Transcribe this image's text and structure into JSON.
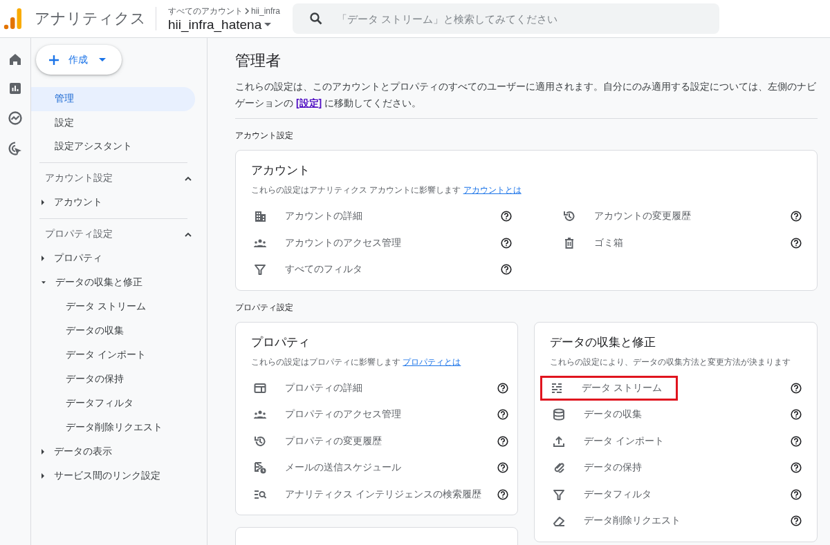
{
  "header": {
    "app_name": "アナリティクス",
    "breadcrumb": [
      "すべてのアカウント",
      "hii_infra"
    ],
    "property": "hii_infra_hatena",
    "search": {
      "placeholder": "「データ ストリーム」と検索してみてください"
    }
  },
  "create_button": {
    "label": "作成"
  },
  "nav": {
    "top_items": [
      {
        "label": "管理",
        "selected": true
      },
      {
        "label": "設定",
        "selected": false
      },
      {
        "label": "設定アシスタント",
        "selected": false
      }
    ],
    "sections": [
      {
        "title": "アカウント設定",
        "expanded": true,
        "items": [
          {
            "label": "アカウント",
            "expanded": false
          }
        ]
      },
      {
        "title": "プロパティ設定",
        "expanded": true,
        "items": [
          {
            "label": "プロパティ",
            "expanded": false
          },
          {
            "label": "データの収集と修正",
            "expanded": true,
            "children": [
              {
                "label": "データ ストリーム"
              },
              {
                "label": "データの収集"
              },
              {
                "label": "データ インポート"
              },
              {
                "label": "データの保持"
              },
              {
                "label": "データフィルタ"
              },
              {
                "label": "データ削除リクエスト"
              }
            ]
          },
          {
            "label": "データの表示",
            "expanded": false
          },
          {
            "label": "サービス間のリンク設定",
            "expanded": false
          }
        ]
      }
    ]
  },
  "main": {
    "title": "管理者",
    "description": {
      "text": "これらの設定は、このアカウントとプロパティのすべてのユーザーに適用されます。自分にのみ適用する設定については、左側のナビゲーションの",
      "link": "[設定]",
      "text_after": "に移動してください。"
    },
    "account_settings": {
      "heading": "アカウント設定",
      "card": {
        "title": "アカウント",
        "subtitle": "これらの設定はアナリティクス アカウントに影響します",
        "link": "アカウントとは",
        "items": [
          {
            "kind": "building",
            "label": "アカウントの詳細",
            "highlighted": false
          },
          {
            "kind": "people",
            "label": "アカウントのアクセス管理",
            "highlighted": false
          },
          {
            "kind": "filter",
            "label": "すべてのフィルタ",
            "highlighted": false
          },
          {
            "kind": "history",
            "label": "アカウントの変更履歴",
            "highlighted": false
          },
          {
            "kind": "trash",
            "label": "ゴミ箱",
            "highlighted": false
          }
        ]
      }
    },
    "property_settings": {
      "heading": "プロパティ設定",
      "columns": [
        [
          {
            "kind": "card",
            "title": "プロパティ",
            "subtitle": "これらの設定はプロパティに影響します",
            "link": "プロパティとは",
            "items": [
              {
                "kind": "window",
                "label": "プロパティの詳細",
                "highlighted": false
              },
              {
                "kind": "people",
                "label": "プロパティのアクセス管理",
                "highlighted": false
              },
              {
                "kind": "history",
                "label": "プロパティの変更履歴",
                "highlighted": false
              },
              {
                "kind": "mail-clock",
                "label": "メールの送信スケジュール",
                "highlighted": false
              },
              {
                "kind": "search-list",
                "label": "アナリティクス インテリジェンスの検索履歴",
                "highlighted": false
              }
            ]
          },
          {
            "kind": "partial"
          }
        ],
        [
          {
            "kind": "card",
            "title": "データの収集と修正",
            "subtitle": "これらの設定により、データの収集方法と変更方法が決まります",
            "items": [
              {
                "kind": "stream",
                "label": "データ ストリーム",
                "highlighted": true
              },
              {
                "kind": "database",
                "label": "データの収集",
                "highlighted": false
              },
              {
                "kind": "upload",
                "label": "データ インポート",
                "highlighted": false
              },
              {
                "kind": "clip",
                "label": "データの保持",
                "highlighted": false
              },
              {
                "kind": "filter",
                "label": "データフィルタ",
                "highlighted": false
              },
              {
                "kind": "eraser",
                "label": "データ削除リクエスト",
                "highlighted": false
              }
            ]
          }
        ]
      ]
    }
  }
}
